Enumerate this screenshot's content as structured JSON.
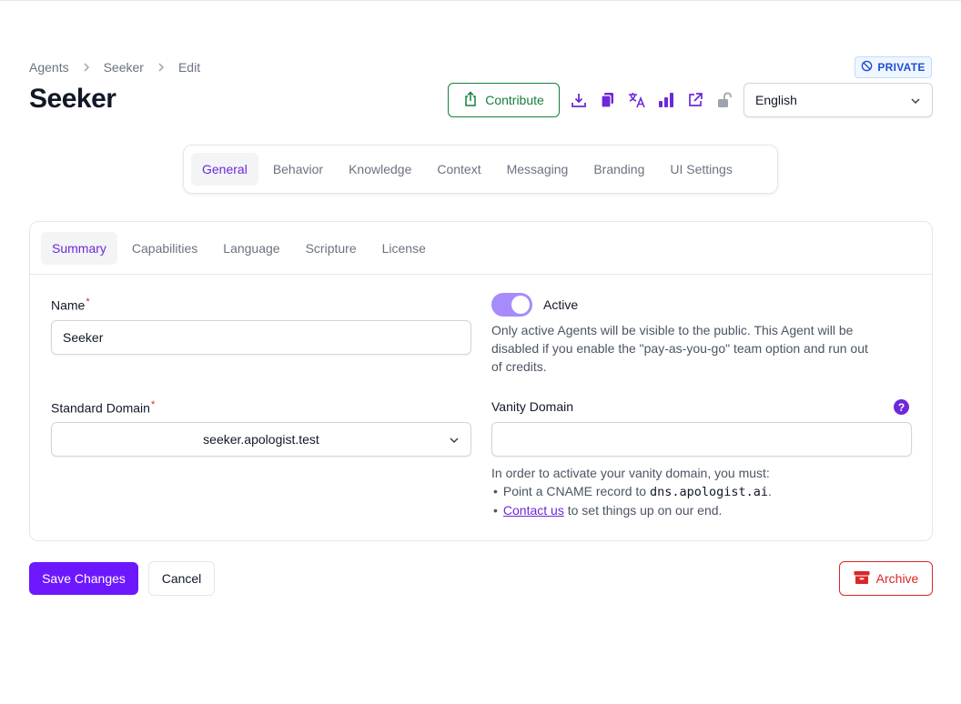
{
  "breadcrumb": {
    "items": [
      "Agents",
      "Seeker",
      "Edit"
    ]
  },
  "badge": {
    "label": "PRIVATE"
  },
  "page": {
    "title": "Seeker"
  },
  "toolbar": {
    "contribute_label": "Contribute",
    "icons": [
      "download-icon",
      "copy-icon",
      "translate-icon",
      "analytics-icon",
      "external-link-icon",
      "unlock-icon"
    ],
    "language_value": "English"
  },
  "main_tabs": [
    {
      "label": "General",
      "active": true
    },
    {
      "label": "Behavior",
      "active": false
    },
    {
      "label": "Knowledge",
      "active": false
    },
    {
      "label": "Context",
      "active": false
    },
    {
      "label": "Messaging",
      "active": false
    },
    {
      "label": "Branding",
      "active": false
    },
    {
      "label": "UI Settings",
      "active": false
    }
  ],
  "sub_tabs": [
    {
      "label": "Summary",
      "active": true
    },
    {
      "label": "Capabilities",
      "active": false
    },
    {
      "label": "Language",
      "active": false
    },
    {
      "label": "Scripture",
      "active": false
    },
    {
      "label": "License",
      "active": false
    }
  ],
  "form": {
    "name_label": "Name",
    "name_value": "Seeker",
    "required_mark": "*",
    "active_label": "Active",
    "active_on": true,
    "active_help_lines": [
      "Only active Agents will be visible to the public. This Agent will be",
      "disabled if you enable the \"pay-as-you-go\" team option and run out",
      "of credits."
    ],
    "standard_domain_label": "Standard Domain",
    "standard_domain_value": "seeker.apologist.test",
    "vanity_domain_label": "Vanity Domain",
    "vanity_domain_value": "",
    "help_icon_glyph": "?",
    "vanity_help_intro": "In order to activate your vanity domain, you must:",
    "bullet_glyph": "•",
    "vanity_step1_prefix": "Point a CNAME record to",
    "vanity_step1_code": "dns.apologist.ai",
    "vanity_step1_suffix": ".",
    "vanity_step2_link": "Contact us",
    "vanity_step2_suffix": "to set things up on our end."
  },
  "actions": {
    "save_label": "Save Changes",
    "cancel_label": "Cancel",
    "archive_label": "Archive"
  },
  "colors": {
    "accent": "#6d28d9",
    "primary_button": "#6d17ff",
    "success": "#15803d",
    "danger": "#dc2626",
    "badge": "#1d4ed8"
  }
}
